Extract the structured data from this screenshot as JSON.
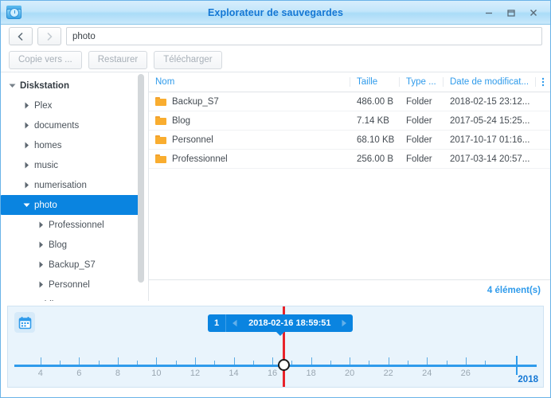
{
  "window": {
    "title": "Explorateur de sauvegardes",
    "app_icon": "backup-folder-clock-icon",
    "controls": {
      "minimize": "minimize-icon",
      "maximize": "maximize-icon",
      "close": "close-icon"
    }
  },
  "address_bar": {
    "back_icon": "chevron-left-icon",
    "forward_icon": "chevron-right-icon",
    "path_value": "photo",
    "path_placeholder": "photo"
  },
  "toolbar": {
    "buttons": [
      {
        "label": "Copie vers ...",
        "name": "copy-to-button"
      },
      {
        "label": "Restaurer",
        "name": "restore-button"
      },
      {
        "label": "Télécharger",
        "name": "download-button"
      }
    ]
  },
  "sidebar": {
    "items": [
      {
        "label": "Diskstation",
        "depth": 0,
        "state": "expanded",
        "selected": false
      },
      {
        "label": "Plex",
        "depth": 1,
        "state": "collapsed",
        "selected": false
      },
      {
        "label": "documents",
        "depth": 1,
        "state": "collapsed",
        "selected": false
      },
      {
        "label": "homes",
        "depth": 1,
        "state": "collapsed",
        "selected": false
      },
      {
        "label": "music",
        "depth": 1,
        "state": "collapsed",
        "selected": false
      },
      {
        "label": "numerisation",
        "depth": 1,
        "state": "collapsed",
        "selected": false
      },
      {
        "label": "photo",
        "depth": 1,
        "state": "expanded",
        "selected": true
      },
      {
        "label": "Professionnel",
        "depth": 2,
        "state": "collapsed",
        "selected": false
      },
      {
        "label": "Blog",
        "depth": 2,
        "state": "collapsed",
        "selected": false
      },
      {
        "label": "Backup_S7",
        "depth": 2,
        "state": "collapsed",
        "selected": false
      },
      {
        "label": "Personnel",
        "depth": 2,
        "state": "collapsed",
        "selected": false
      },
      {
        "label": "public",
        "depth": 1,
        "state": "collapsed",
        "selected": false
      }
    ]
  },
  "file_list": {
    "columns": {
      "name": "Nom",
      "size": "Taille",
      "type": "Type ...",
      "date": "Date de modificat...",
      "menu_icon": "column-options-icon"
    },
    "rows": [
      {
        "name": "Backup_S7",
        "size": "486.00 B",
        "type": "Folder",
        "date": "2018-02-15 23:12..."
      },
      {
        "name": "Blog",
        "size": "7.14 KB",
        "type": "Folder",
        "date": "2017-05-24 15:25..."
      },
      {
        "name": "Personnel",
        "size": "68.10 KB",
        "type": "Folder",
        "date": "2017-10-17 01:16..."
      },
      {
        "name": "Professionnel",
        "size": "256.00 B",
        "type": "Folder",
        "date": "2017-03-14 20:57..."
      }
    ],
    "footer_count": "4 élément(s)"
  },
  "timeline": {
    "calendar_icon": "calendar-icon",
    "snapshot_index": "1",
    "prev_icon": "triangle-left-icon",
    "next_icon": "triangle-right-icon",
    "selected_date": "2018-02-16 18:59:51",
    "year_label": "2018",
    "tick_labels": [
      "4",
      "6",
      "8",
      "10",
      "12",
      "14",
      "16",
      "18",
      "20",
      "22",
      "24",
      "26"
    ]
  },
  "colors": {
    "accent": "#0a84e0",
    "link": "#2f9beb",
    "title": "#1477d4",
    "marker": "#e8232a",
    "folder": "#f9ad2f"
  }
}
